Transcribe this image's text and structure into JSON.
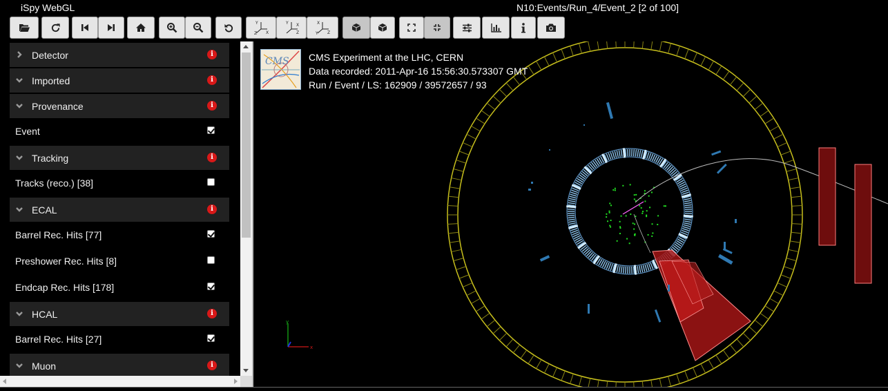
{
  "window": {
    "app_title": "iSpy WebGL",
    "event_title": "N10:Events/Run_4/Event_2 [2 of 100]"
  },
  "toolbar": {
    "buttons": [
      {
        "name": "open-file-button",
        "icon": "folder-open-icon"
      },
      {
        "name": "reload-button",
        "icon": "reload-icon"
      },
      {
        "name": "previous-event-button",
        "icon": "step-backward-icon"
      },
      {
        "name": "next-event-button",
        "icon": "step-forward-icon"
      },
      {
        "name": "home-view-button",
        "icon": "home-icon"
      },
      {
        "name": "zoom-in-button",
        "icon": "zoom-in-icon"
      },
      {
        "name": "zoom-out-button",
        "icon": "zoom-out-icon"
      },
      {
        "name": "reset-view-button",
        "icon": "undo-icon"
      },
      {
        "name": "view-yx-button",
        "icon": "axes-yx-icon"
      },
      {
        "name": "view-xz-button",
        "icon": "axes-xz-icon"
      },
      {
        "name": "view-yz-button",
        "icon": "axes-yz-icon"
      },
      {
        "name": "perspective-button",
        "icon": "cube-perspective-icon",
        "active": true
      },
      {
        "name": "orthographic-button",
        "icon": "cube-orthographic-icon"
      },
      {
        "name": "fullscreen-button",
        "icon": "expand-icon"
      },
      {
        "name": "exit-fullscreen-button",
        "icon": "compress-icon",
        "active": true
      },
      {
        "name": "settings-button",
        "icon": "sliders-icon"
      },
      {
        "name": "table-view-button",
        "icon": "bar-chart-icon"
      },
      {
        "name": "about-button",
        "icon": "info-icon"
      },
      {
        "name": "screenshot-button",
        "icon": "camera-icon"
      }
    ]
  },
  "sidebar": {
    "sections": [
      {
        "label": "Detector",
        "expanded": false,
        "items": []
      },
      {
        "label": "Imported",
        "expanded": true,
        "items": []
      },
      {
        "label": "Provenance",
        "expanded": true,
        "items": [
          {
            "label": "Event",
            "checked": true
          }
        ]
      },
      {
        "label": "Tracking",
        "expanded": true,
        "items": [
          {
            "label": "Tracks (reco.) [38]",
            "checked": false
          }
        ]
      },
      {
        "label": "ECAL",
        "expanded": true,
        "items": [
          {
            "label": "Barrel Rec. Hits [77]",
            "checked": true
          },
          {
            "label": "Preshower Rec. Hits [8]",
            "checked": false
          },
          {
            "label": "Endcap Rec. Hits [178]",
            "checked": true
          }
        ]
      },
      {
        "label": "HCAL",
        "expanded": true,
        "items": [
          {
            "label": "Barrel Rec. Hits [27]",
            "checked": true
          }
        ]
      },
      {
        "label": "Muon",
        "expanded": true,
        "items": []
      }
    ]
  },
  "event_info": {
    "line1": "CMS Experiment at the LHC, CERN",
    "line2": "Data recorded: 2011-Apr-16 15:56:30.573307 GMT",
    "line3": "Run / Event / LS: 162909 / 39572657 / 93",
    "logo_text": "CMS"
  },
  "axes_labels": {
    "x": "x",
    "y": "y"
  },
  "colors": {
    "info_badge": "#d81818",
    "detector_ring": "#c8c01c",
    "ecal_barrel": "#8fc4ec",
    "hcal_tower": "#b81c1c",
    "muon_chamber": "#6e0d0d",
    "tracker_hits": "#22dd22"
  }
}
